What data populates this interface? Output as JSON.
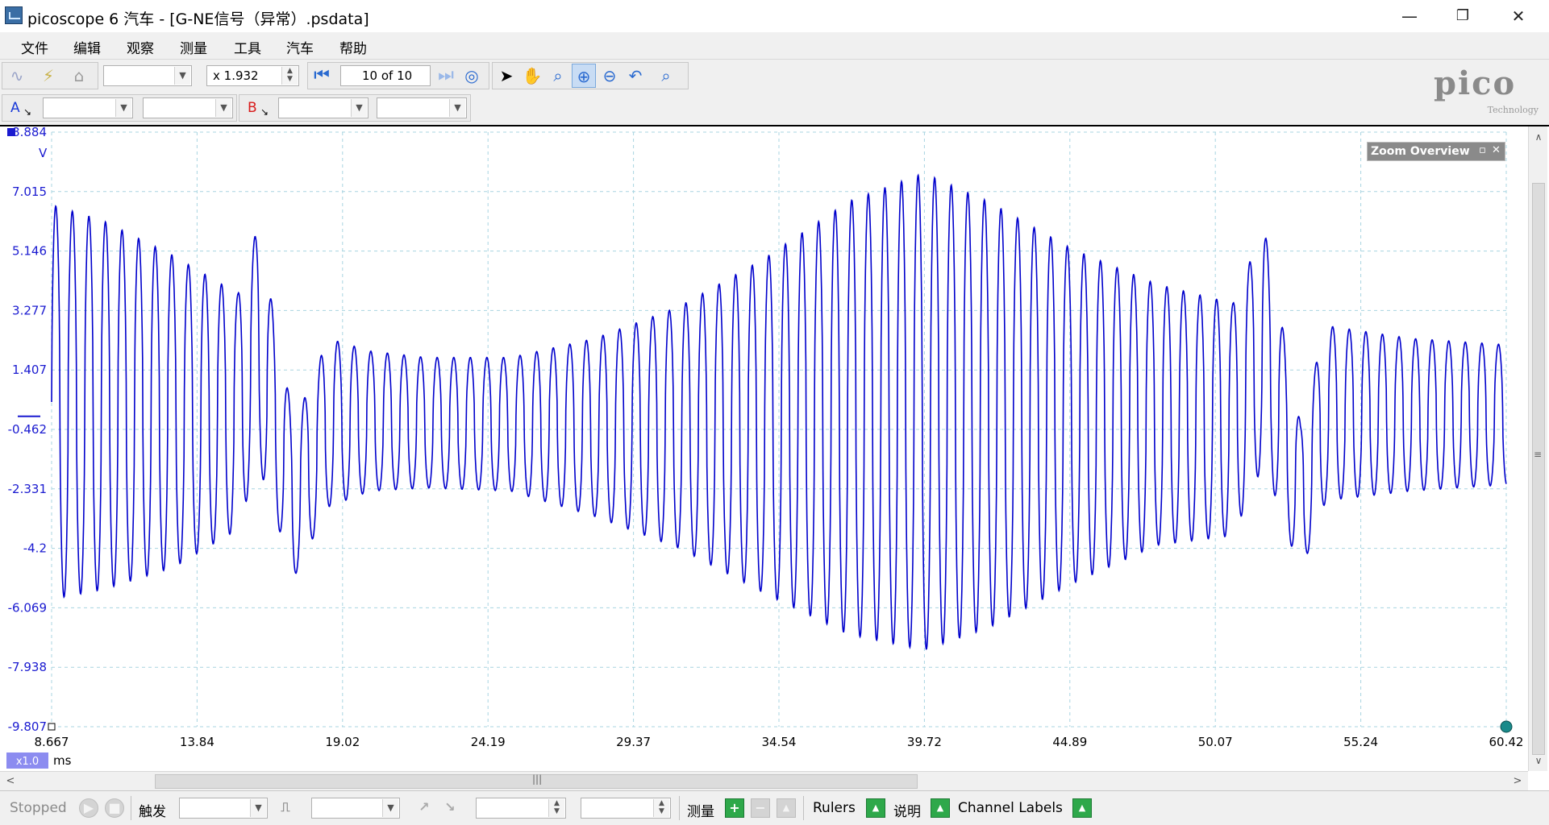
{
  "window": {
    "title": "picoscope 6 汽车 - [G-NE信号（异常）.psdata]",
    "minimize": "—",
    "restore": "❐",
    "close": "✕"
  },
  "menu": [
    "文件",
    "编辑",
    "观察",
    "测量",
    "工具",
    "汽车",
    "帮助"
  ],
  "toolbar": {
    "zoom_factor": "x 1.932",
    "buffer_page": "10 of 10"
  },
  "channels": {
    "a_label": "A",
    "b_label": "B"
  },
  "logo": {
    "main": "pico",
    "sub": "Technology"
  },
  "zoom_overview": {
    "label": "Zoom Overview",
    "pin": "▫",
    "close": "✕"
  },
  "plot": {
    "y_unit": "V",
    "x_unit": "ms",
    "x_zoom_badge": "x1.0",
    "trace_color": "#0000cc"
  },
  "chart_data": {
    "type": "line",
    "title": "",
    "xlabel": "ms",
    "ylabel": "V",
    "xlim": [
      8.667,
      60.42
    ],
    "ylim": [
      -9.807,
      8.884
    ],
    "grid": true,
    "y_ticks": [
      "8.884",
      "7.015",
      "5.146",
      "3.277",
      "1.407",
      "-0.462",
      "-2.331",
      "-4.2",
      "-6.069",
      "-7.938",
      "-9.807"
    ],
    "x_ticks": [
      "8.667",
      "13.84",
      "19.02",
      "24.19",
      "29.37",
      "34.54",
      "39.72",
      "44.89",
      "50.07",
      "55.24",
      "60.42"
    ],
    "series": [
      {
        "color": "#0000cc",
        "signal_period_ms": 0.59,
        "envelope": [
          {
            "t": 8.667,
            "max": 6.6,
            "min": -5.8
          },
          {
            "t": 10.5,
            "max": 6.1,
            "min": -5.5
          },
          {
            "t": 13.0,
            "max": 5.0,
            "min": -4.8
          },
          {
            "t": 15.3,
            "max": 3.8,
            "min": -3.6
          },
          {
            "t": 16.0,
            "max": 5.9,
            "min": -1.5
          },
          {
            "t": 17.3,
            "max": -0.3,
            "min": -5.1
          },
          {
            "t": 18.5,
            "max": 2.4,
            "min": -2.9
          },
          {
            "t": 20.0,
            "max": 2.0,
            "min": -2.4
          },
          {
            "t": 22.0,
            "max": 1.8,
            "min": -2.3
          },
          {
            "t": 25.0,
            "max": 1.8,
            "min": -2.4
          },
          {
            "t": 28.0,
            "max": 2.4,
            "min": -3.2
          },
          {
            "t": 31.0,
            "max": 3.4,
            "min": -4.2
          },
          {
            "t": 34.0,
            "max": 4.9,
            "min": -5.6
          },
          {
            "t": 37.0,
            "max": 6.7,
            "min": -6.9
          },
          {
            "t": 39.7,
            "max": 7.6,
            "min": -7.4
          },
          {
            "t": 42.0,
            "max": 6.7,
            "min": -6.7
          },
          {
            "t": 45.0,
            "max": 5.2,
            "min": -5.3
          },
          {
            "t": 48.0,
            "max": 4.1,
            "min": -4.1
          },
          {
            "t": 50.7,
            "max": 3.5,
            "min": -3.8
          },
          {
            "t": 51.8,
            "max": 5.9,
            "min": -1.5
          },
          {
            "t": 53.1,
            "max": -0.3,
            "min": -5.0
          },
          {
            "t": 54.0,
            "max": 2.8,
            "min": -2.7
          },
          {
            "t": 57.0,
            "max": 2.4,
            "min": -2.4
          },
          {
            "t": 60.42,
            "max": 2.2,
            "min": -2.2
          }
        ]
      }
    ]
  },
  "status": {
    "state": "Stopped",
    "trigger_label": "触发",
    "measure_label": "测量",
    "rulers_label": "Rulers",
    "notes_label": "说明",
    "channel_labels_label": "Channel Labels"
  }
}
